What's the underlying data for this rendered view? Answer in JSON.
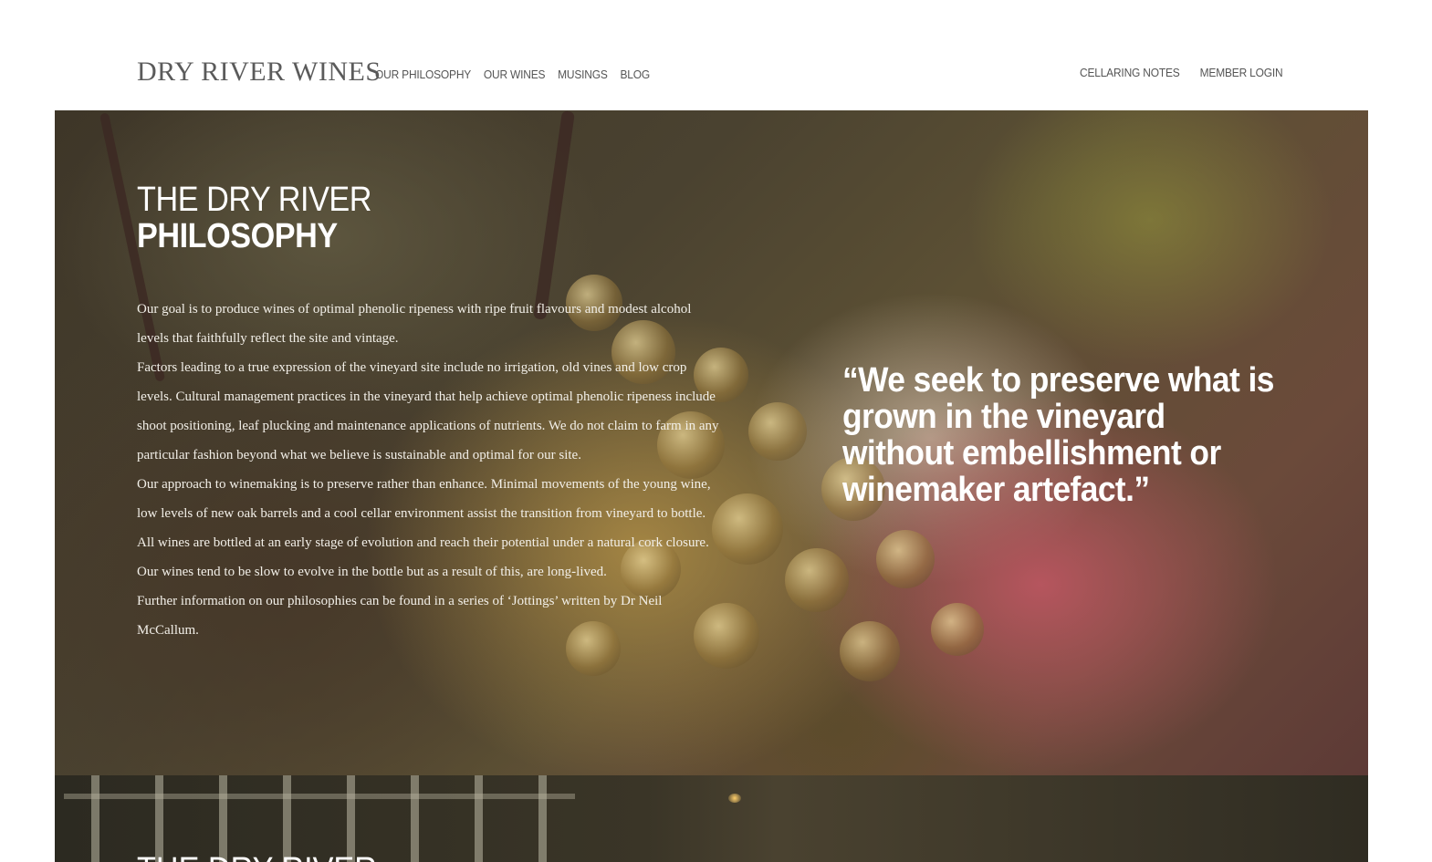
{
  "brand": {
    "logo_text": "DRY RIVER WINES"
  },
  "nav": {
    "left": [
      {
        "label": "OUR PHILOSOPHY"
      },
      {
        "label": "OUR WINES"
      },
      {
        "label": "MUSINGS"
      },
      {
        "label": "BLOG"
      }
    ],
    "right": [
      {
        "label": "CELLARING NOTES"
      },
      {
        "label": "MEMBER LOGIN"
      }
    ]
  },
  "hero": {
    "title_line1": "THE DRY RIVER",
    "title_line2": "PHILOSOPHY",
    "paragraphs": [
      "Our goal is to produce wines of optimal phenolic ripeness with ripe fruit flavours and modest alcohol levels that faithfully reflect the site and vintage.",
      "Factors leading to a true expression of the vineyard site include no irrigation, old vines and low crop levels. Cultural management practices in the vineyard that help achieve optimal phenolic ripeness include shoot positioning, leaf plucking and maintenance applications of nutrients. We do not claim to farm in any particular fashion beyond what we believe is sustainable and optimal for our site.",
      "Our approach to winemaking is to preserve rather than enhance. Minimal movements of the young wine, low levels of new oak barrels and a cool cellar environment assist the transition from vineyard to bottle.",
      "All wines are bottled at an early stage of evolution and reach their potential under a natural cork closure. Our wines tend to be slow to evolve in the bottle but as a result of this, are long-lived.",
      "Further information on our philosophies can be found in a series of ‘Jottings’ written by Dr Neil McCallum."
    ],
    "quote": "“We seek to preserve what is grown in the vineyard without embellishment or winemaker artefact.”"
  },
  "section2": {
    "title_partial": "THE DRY RIVER"
  }
}
